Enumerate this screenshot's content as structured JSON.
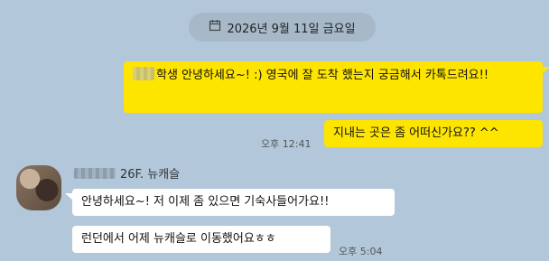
{
  "date_divider": {
    "label": "2026년 9월 11일 금요일",
    "icon": "calendar-icon"
  },
  "messages": {
    "outgoing": [
      {
        "text": "학생 안녕하세요~! :) 영국에 잘 도착 했는지 궁금해서 카톡드려요!!"
      },
      {
        "text": "지내는 곳은 좀 어떠신가요?? ^^",
        "time": "오후 12:41"
      }
    ],
    "incoming": {
      "sender": "26F. 뉴캐슬",
      "items": [
        {
          "text": "안녕하세요~! 저 이제 좀 있으면 기숙사들어가요!!"
        },
        {
          "text": "런던에서 어제 뉴캐슬로 이동했어요ㅎㅎ",
          "time": "오후 5:04"
        }
      ]
    }
  },
  "colors": {
    "background": "#b2c7d9",
    "outgoing_bubble": "#fee500",
    "incoming_bubble": "#ffffff"
  }
}
